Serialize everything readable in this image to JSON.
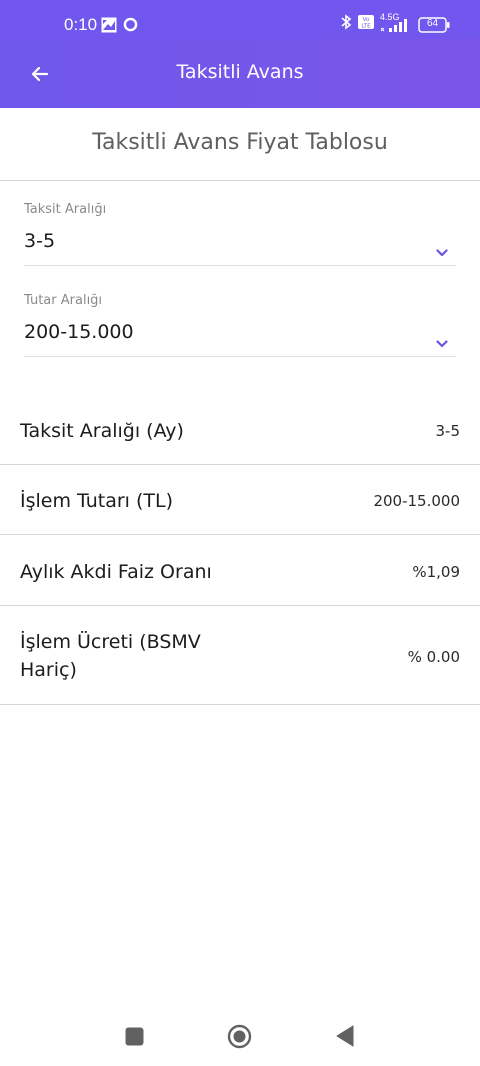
{
  "status_bar": {
    "time": "0:10",
    "battery": "64",
    "network": "4.5G",
    "icons": [
      "gallery-icon",
      "circle-icon",
      "bluetooth-icon",
      "volte-icon",
      "signal-icon",
      "battery-icon"
    ]
  },
  "app_bar": {
    "title": "Taksitli Avans",
    "back_icon": "arrow-left-icon"
  },
  "page": {
    "heading": "Taksitli Avans Fiyat Tablosu"
  },
  "filters": [
    {
      "label": "Taksit Aralığı",
      "value": "3-5"
    },
    {
      "label": "Tutar Aralığı",
      "value": "200-15.000"
    }
  ],
  "table": {
    "rows": [
      {
        "label": "Taksit Aralığı (Ay)",
        "value": "3-5"
      },
      {
        "label": "İşlem Tutarı (TL)",
        "value": "200-15.000"
      },
      {
        "label": "Aylık Akdi Faiz Oranı",
        "value": "%1,09"
      },
      {
        "label": "İşlem Ücreti (BSMV\nHariç)",
        "value": "% 0.00"
      }
    ]
  },
  "colors": {
    "primary": "#7157ee",
    "accent_chevron": "#6a55e0"
  },
  "nav_bar": {
    "icons": [
      "recents-square-icon",
      "home-circle-icon",
      "back-triangle-icon"
    ]
  }
}
